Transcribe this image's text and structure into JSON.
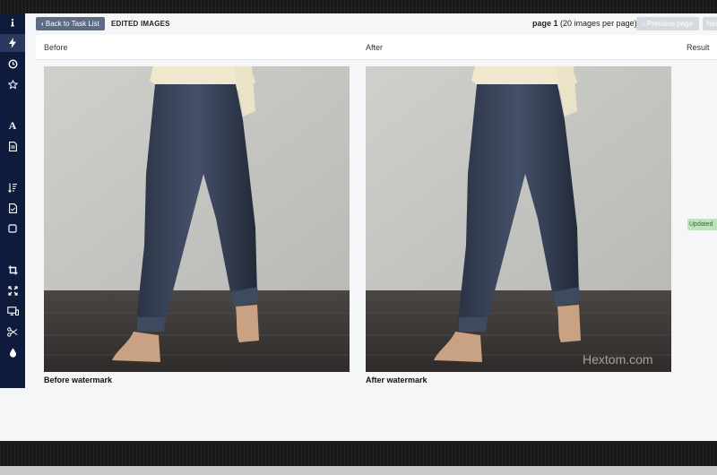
{
  "toolbar": {
    "back_label": "Back to Task List",
    "title": "EDITED IMAGES",
    "page_label": "page 1",
    "page_suffix": "(20 images per page)",
    "prev_label": "Previous page",
    "next_label": "Next"
  },
  "table": {
    "col_before": "Before",
    "col_after": "After",
    "col_result": "Result"
  },
  "row": {
    "before_caption": "Before watermark",
    "after_caption": "After watermark",
    "watermark_text": "Hextom.com",
    "result_badge": "Updated"
  },
  "sidebar_icons": [
    "info-icon",
    "bolt-icon",
    "clock-icon",
    "star-icon",
    "font-icon",
    "file-icon",
    "sort-icon",
    "document-icon",
    "square-icon",
    "crop-icon",
    "expand-icon",
    "monitor-icon",
    "scissors-icon",
    "drop-icon"
  ],
  "colors": {
    "sidebar": "#0f1b3d",
    "back_button": "#5d6b85",
    "badge_bg": "#bfe3bf"
  }
}
